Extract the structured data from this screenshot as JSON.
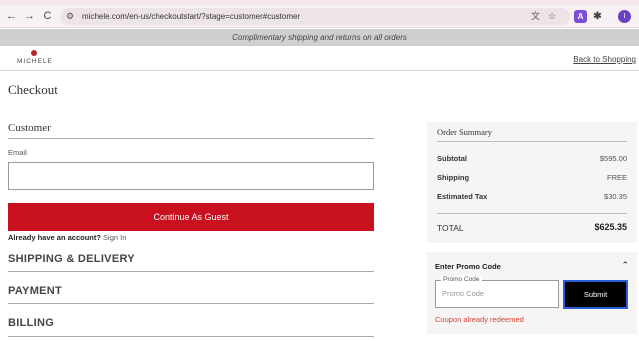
{
  "browser": {
    "back_icon": "←",
    "forward_icon": "→",
    "reload_icon": "C",
    "site_info_icon": "⚙",
    "url": "michele.com/en-us/checkoutstart/?stage=customer#customer",
    "translate_icon": "文",
    "star_icon": "☆",
    "ext_label": "A",
    "puzzle_icon": "✱",
    "profile_initial": "I"
  },
  "banner": {
    "text": "Complimentary shipping and returns on all orders"
  },
  "header": {
    "logo_text": "MICHELE",
    "back_link": "Back to Shopping"
  },
  "page": {
    "title": "Checkout"
  },
  "customer": {
    "title": "Customer",
    "email_label": "Email",
    "email_value": "",
    "guest_button": "Continue As Guest",
    "account_question": "Already have an account?",
    "sign_in": "Sign In"
  },
  "steps": {
    "shipping": "SHIPPING & DELIVERY",
    "payment": "PAYMENT",
    "billing": "BILLING"
  },
  "summary": {
    "title": "Order Summary",
    "subtotal_label": "Subtotal",
    "subtotal_value": "$595.00",
    "shipping_label": "Shipping",
    "shipping_value": "FREE",
    "tax_label": "Estimated Tax",
    "tax_value": "$30.35",
    "total_label": "TOTAL",
    "total_value": "$625.35"
  },
  "promo": {
    "title": "Enter Promo Code",
    "chevron_icon": "⌃",
    "field_legend": "Promo Code",
    "placeholder": "Promo Code",
    "submit": "Submit",
    "error": "Coupon already redeemed"
  },
  "colors": {
    "brand_red": "#c8101f",
    "error_red": "#d4453b",
    "focus_blue": "#2b5fd9"
  }
}
